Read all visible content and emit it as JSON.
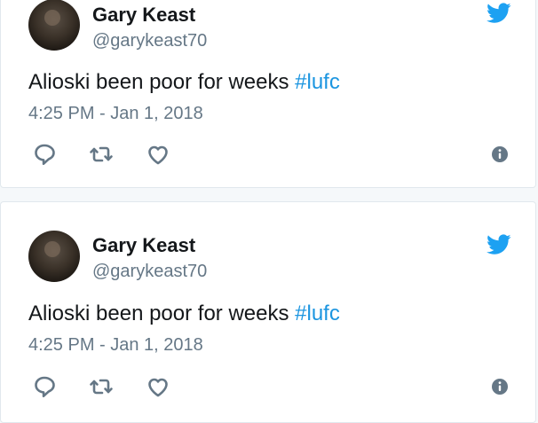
{
  "tweets": [
    {
      "name": "Gary Keast",
      "handle": "@garykeast70",
      "text": "Alioski been poor for weeks ",
      "hashtag": "#lufc",
      "timestamp": "4:25 PM - Jan 1, 2018",
      "icons": [
        "reply-icon",
        "retweet-icon",
        "like-icon",
        "info-icon",
        "twitter-bird-icon"
      ]
    },
    {
      "name": "Gary Keast",
      "handle": "@garykeast70",
      "text": "Alioski been poor for weeks ",
      "hashtag": "#lufc",
      "timestamp": "4:25 PM - Jan 1, 2018",
      "icons": [
        "reply-icon",
        "retweet-icon",
        "like-icon",
        "info-icon",
        "twitter-bird-icon"
      ]
    }
  ],
  "colors": {
    "brand": "#1da1f2",
    "hashtag": "#1b95e0",
    "secondary_text": "#657786",
    "icon": "#657786"
  }
}
